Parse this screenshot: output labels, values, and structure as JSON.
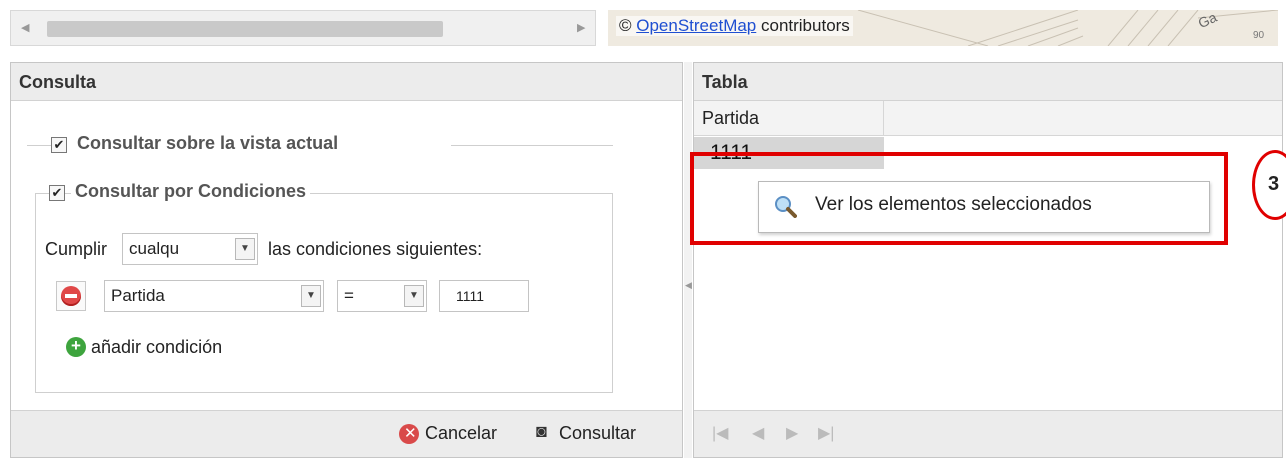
{
  "map": {
    "attribution_prefix": "© ",
    "attribution_link": "OpenStreetMap",
    "attribution_suffix": " contributors",
    "street_text": "Ga",
    "number_text": "90"
  },
  "consulta": {
    "title": "Consulta",
    "vista_label": "Consultar sobre la vista actual",
    "condiciones_label": "Consultar por Condiciones",
    "cumplir_label": "Cumplir",
    "cumplir_value": "cualqu",
    "siguientes_label": "las condiciones siguientes:",
    "field_value": "Partida",
    "operator_value": "=",
    "condition_value": "1111",
    "add_condition_label": "añadir condición",
    "cancel_label": "Cancelar",
    "query_label": "Consultar"
  },
  "tabla": {
    "title": "Tabla",
    "column_header": "Partida",
    "row_value": "1111",
    "context_menu_item": "Ver los elementos seleccionados"
  },
  "annotation": {
    "step_number": "3"
  },
  "colors": {
    "highlight": "#e00000",
    "link": "#1f4fd1"
  }
}
